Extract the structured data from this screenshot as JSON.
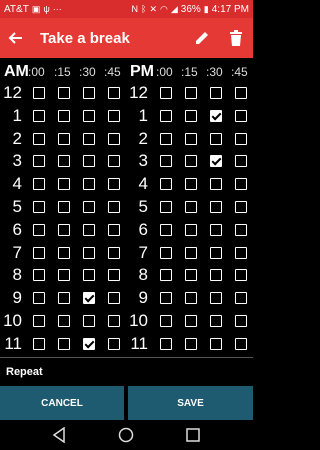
{
  "status": {
    "carrier": "AT&T",
    "battery": "36%",
    "time": "4:17 PM"
  },
  "appbar": {
    "title": "Take a break"
  },
  "schedule": {
    "am_label": "AM",
    "pm_label": "PM",
    "minutes": [
      ":00",
      ":15",
      ":30",
      ":45"
    ],
    "hours": [
      "12",
      "1",
      "2",
      "3",
      "4",
      "5",
      "6",
      "7",
      "8",
      "9",
      "10",
      "11"
    ],
    "am_checked": [
      [],
      [],
      [],
      [],
      [],
      [],
      [],
      [],
      [],
      [
        2
      ],
      [],
      [
        2
      ]
    ],
    "pm_checked": [
      [],
      [
        2
      ],
      [],
      [
        2
      ],
      [],
      [],
      [],
      [],
      [],
      [],
      [],
      []
    ]
  },
  "repeat_label": "Repeat",
  "buttons": {
    "cancel": "CANCEL",
    "save": "SAVE"
  }
}
